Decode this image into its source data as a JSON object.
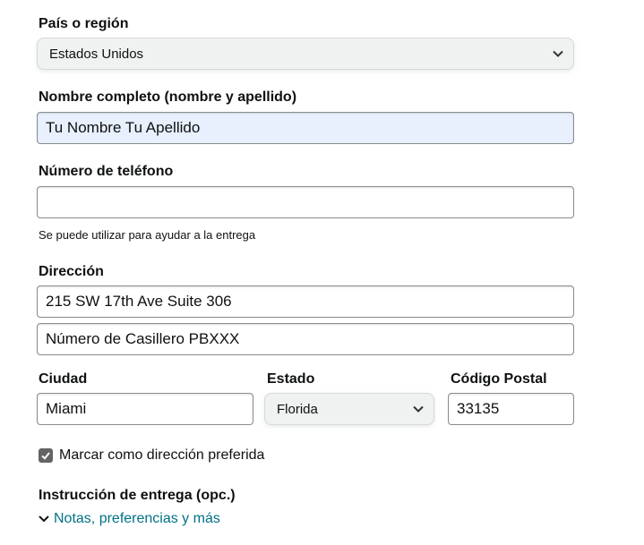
{
  "country": {
    "label": "País o región",
    "selected": "Estados Unidos"
  },
  "full_name": {
    "label": "Nombre completo (nombre y apellido)",
    "value": "Tu Nombre Tu Apellido"
  },
  "phone": {
    "label": "Número de teléfono",
    "value": "",
    "hint": "Se puede utilizar para ayudar a la entrega"
  },
  "address": {
    "label": "Dirección",
    "line1": "215 SW 17th Ave Suite 306",
    "line2": "Número de Casillero PBXXX"
  },
  "city": {
    "label": "Ciudad",
    "value": "Miami"
  },
  "state": {
    "label": "Estado",
    "selected": "Florida"
  },
  "postal_code": {
    "label": "Código Postal",
    "value": "33135"
  },
  "preferred": {
    "label": "Marcar como dirección preferida",
    "checked": true
  },
  "delivery": {
    "label": "Instrucción de entrega (opc.)",
    "link": "Notas, preferencias y más"
  },
  "colors": {
    "link": "#007185",
    "autofill_bg": "#e8f0fe",
    "select_bg": "#f0f2f2",
    "checkbox": "#646464"
  },
  "icons": {
    "select_arrow": "chevron-down-icon",
    "checkbox": "checkmark-icon",
    "expand": "chevron-down-icon"
  }
}
